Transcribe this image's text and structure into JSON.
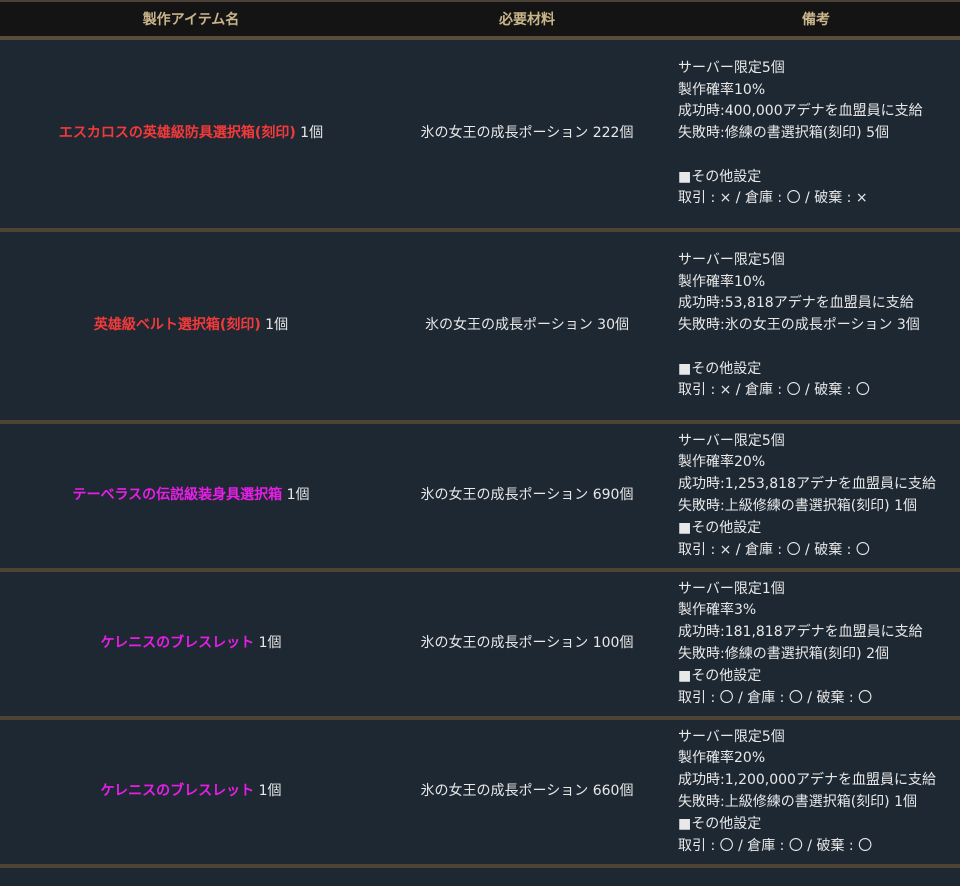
{
  "headers": [
    "製作アイテム名",
    "必要材料",
    "備考"
  ],
  "colors": {
    "red": "#f23a3a",
    "magenta": "#e81ee8",
    "header_text": "#c9b58a"
  },
  "rows": [
    {
      "item": "エスカロスの英雄級防具選択箱(刻印)",
      "item_color": "#f23a3a",
      "qty": " 1個",
      "material": "氷の女王の成長ポーション 222個",
      "notes": [
        "サーバー限定5個",
        "製作確率10%",
        "成功時:400,000アデナを血盟員に支給",
        "失敗時:修練の書選択箱(刻印) 5個",
        "",
        "■その他設定",
        "取引 : × / 倉庫 : 〇 / 破棄 : ×"
      ]
    },
    {
      "item": "英雄級ベルト選択箱(刻印)",
      "item_color": "#f23a3a",
      "qty": " 1個",
      "material": "氷の女王の成長ポーション 30個",
      "notes": [
        "サーバー限定5個",
        "製作確率10%",
        "成功時:53,818アデナを血盟員に支給",
        "失敗時:氷の女王の成長ポーション 3個",
        "",
        "■その他設定",
        "取引 : × / 倉庫 : 〇 / 破棄 : 〇"
      ]
    },
    {
      "item": "テーベラスの伝説級装身具選択箱",
      "item_color": "#e81ee8",
      "qty": " 1個",
      "material": "氷の女王の成長ポーション 690個",
      "notes": [
        "サーバー限定5個",
        "製作確率20%",
        "成功時:1,253,818アデナを血盟員に支給",
        "失敗時:上級修練の書選択箱(刻印) 1個",
        "■その他設定",
        "取引 : × / 倉庫 : 〇 / 破棄 : 〇"
      ]
    },
    {
      "item": "ケレニスのブレスレット",
      "item_color": "#e81ee8",
      "qty": " 1個",
      "material": "氷の女王の成長ポーション 100個",
      "notes": [
        "サーバー限定1個",
        "製作確率3%",
        "成功時:181,818アデナを血盟員に支給",
        "失敗時:修練の書選択箱(刻印) 2個",
        "■その他設定",
        "取引 : 〇 / 倉庫 : 〇 / 破棄 : 〇"
      ]
    },
    {
      "item": "ケレニスのブレスレット",
      "item_color": "#e81ee8",
      "qty": " 1個",
      "material": "氷の女王の成長ポーション 660個",
      "notes": [
        "サーバー限定5個",
        "製作確率20%",
        "成功時:1,200,000アデナを血盟員に支給",
        "失敗時:上級修練の書選択箱(刻印) 1個",
        "■その他設定",
        "取引 : 〇 / 倉庫 : 〇 / 破棄 : 〇"
      ]
    }
  ]
}
